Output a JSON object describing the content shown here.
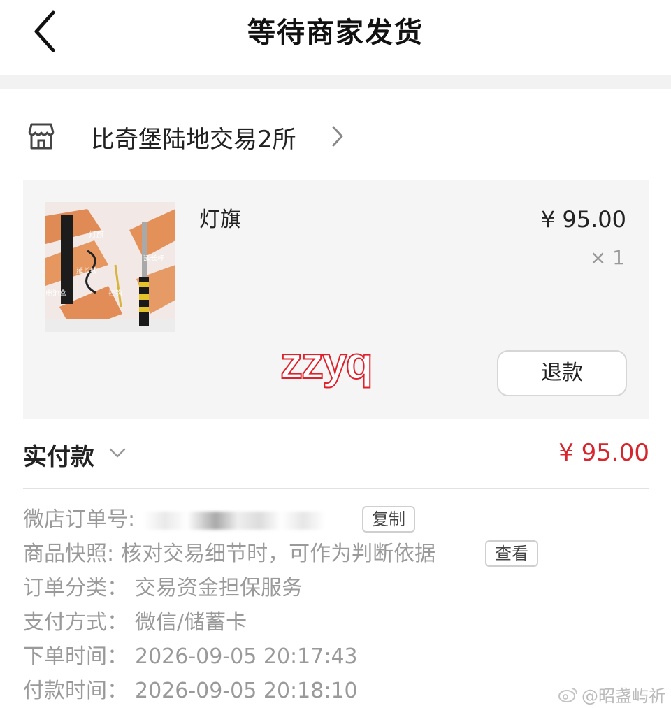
{
  "header": {
    "title": "等待商家发货"
  },
  "shop": {
    "name": "比奇堡陆地交易2所"
  },
  "product": {
    "name": "灯旗",
    "price": "¥ 95.00",
    "quantity": "× 1",
    "image_labels": [
      "灯旗",
      "延长线",
      "延长杆",
      "电池盒",
      "挂钩"
    ],
    "refund_label": "退款",
    "watermark": "zzyq"
  },
  "payment": {
    "label": "实付款",
    "amount": "¥ 95.00"
  },
  "order_info": {
    "order_no_label": "微店订单号:",
    "copy_label": "复制",
    "snapshot_label": "商品快照:",
    "snapshot_value": "核对交易细节时，可作为判断依据",
    "view_label": "查看",
    "category_label": "订单分类：",
    "category_value": "交易资金担保服务",
    "pay_method_label": "支付方式：",
    "pay_method_value": "微信/储蓄卡",
    "order_time_label": "下单时间：",
    "order_time_value": "2026-09-05 20:17:43",
    "pay_time_label": "付款时间：",
    "pay_time_value": "2026-09-05 20:18:10"
  },
  "footer": {
    "weibo_watermark": "@昭盏屿祈"
  },
  "colors": {
    "accent_red": "#d7262e",
    "text_grey": "#9a9a9a"
  },
  "icons": [
    "back-icon",
    "shop-icon",
    "chevron-right-icon",
    "chevron-down-icon",
    "weibo-icon"
  ]
}
